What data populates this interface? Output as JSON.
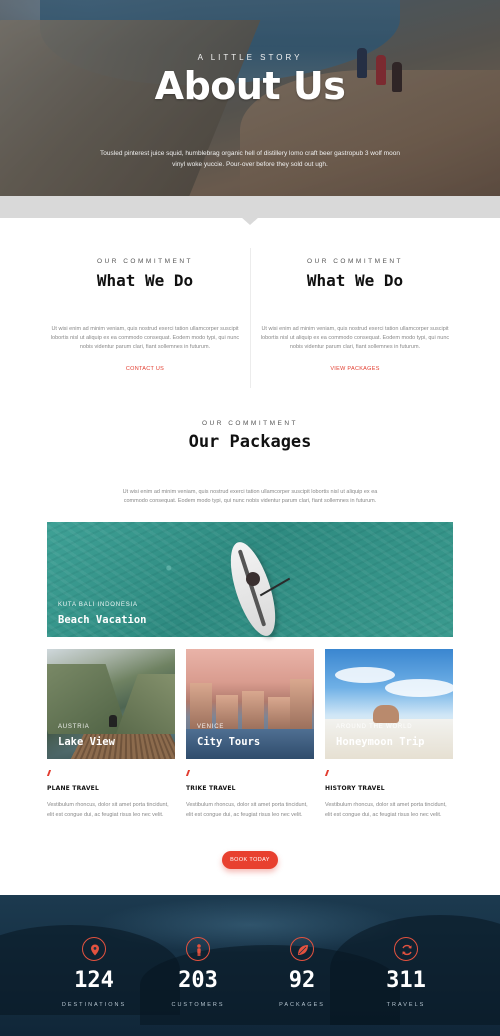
{
  "hero": {
    "kicker": "A LITTLE STORY",
    "title": "About Us",
    "text": "Tousled pinterest juice squid, humblebrag organic hell of distillery lomo craft beer gastropub 3 wolf moon vinyl woke yuccie. Pour-over before they sold out ugh."
  },
  "what_we_do": [
    {
      "kicker": "OUR COMMITMENT",
      "title": "What We Do",
      "body": "Ut wisi enim ad minim veniam, quis nostrud exerci tation ullamcorper suscipit lobortis nisl ut aliquip ex ea commodo consequat. Eodem modo typi, qui nunc nobis videntur parum clari, fiant sollemnes in futurum.",
      "link": "CONTACT US"
    },
    {
      "kicker": "OUR COMMITMENT",
      "title": "What We Do",
      "body": "Ut wisi enim ad minim veniam, quis nostrud exerci tation ullamcorper suscipit lobortis nisl ut aliquip ex ea commodo consequat. Eodem modo typi, qui nunc nobis videntur parum clari, fiant sollemnes in futurum.",
      "link": "VIEW PACKAGES"
    }
  ],
  "packages": {
    "kicker": "OUR COMMITMENT",
    "title": "Our Packages",
    "body": "Ut wisi enim ad minim veniam, quis nostrud exerci tation ullamcorper suscipit lobortis nisl ut aliquip ex ea commodo consequat. Eodem modo typi, qui nunc nobis videntur parum clari, fiant sollemnes in futurum.",
    "banner": {
      "location": "KUTA BALI INDONESIA",
      "title": "Beach Vacation"
    },
    "cards": [
      {
        "location": "AUSTRIA",
        "title": "Lake View"
      },
      {
        "location": "VENICE",
        "title": "City Tours"
      },
      {
        "location": "AROUND THE WORLD",
        "title": "Honeymoon Trip"
      }
    ],
    "info": [
      {
        "title": "PLANE TRAVEL",
        "text": "Vestibulum rhoncus, dolor sit amet porta tincidunt, elit est congue dui, ac feugiat risus leo nec velit."
      },
      {
        "title": "TRIKE TRAVEL",
        "text": "Vestibulum rhoncus, dolor sit amet porta tincidunt, elit est congue dui, ac feugiat risus leo nec velit."
      },
      {
        "title": "HISTORY TRAVEL",
        "text": "Vestibulum rhoncus, dolor sit amet porta tincidunt, elit est congue dui, ac feugiat risus leo nec velit."
      }
    ],
    "book_button": "BOOK TODAY"
  },
  "stats": [
    {
      "icon": "map-pin-icon",
      "number": "124",
      "label": "DESTINATIONS"
    },
    {
      "icon": "person-icon",
      "number": "203",
      "label": "CUSTOMERS"
    },
    {
      "icon": "leaf-icon",
      "number": "92",
      "label": "PACKAGES"
    },
    {
      "icon": "refresh-icon",
      "number": "311",
      "label": "TRAVELS"
    }
  ],
  "colors": {
    "accent": "#e23c2e",
    "dark_bg": "#173246",
    "band": "#d9d9d9"
  }
}
